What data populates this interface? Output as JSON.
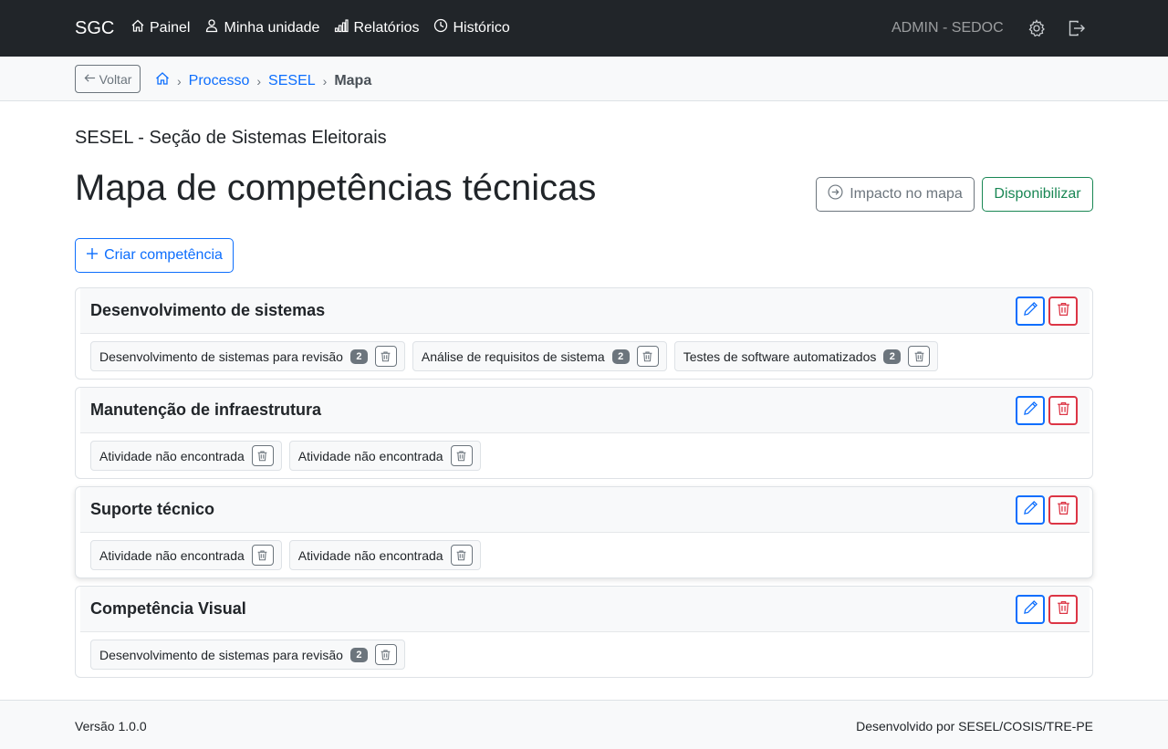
{
  "navbar": {
    "brand": "SGC",
    "links": [
      {
        "label": "Painel",
        "icon": "house-icon"
      },
      {
        "label": "Minha unidade",
        "icon": "person-icon"
      },
      {
        "label": "Relatórios",
        "icon": "bar-chart-icon"
      },
      {
        "label": "Histórico",
        "icon": "clock-icon"
      }
    ],
    "user": "ADMIN - SEDOC",
    "settings_icon": "gear-icon",
    "logout_icon": "logout-icon"
  },
  "breadcrumb": {
    "back_label": "Voltar",
    "items": [
      "Processo",
      "SESEL"
    ],
    "current": "Mapa"
  },
  "header": {
    "unit": "SESEL - Seção de Sistemas Eleitorais",
    "title": "Mapa de competências técnicas",
    "impact_label": "Impacto no mapa",
    "publish_label": "Disponibilizar",
    "create_label": "Criar competência"
  },
  "competencias": [
    {
      "title": "Desenvolvimento de sistemas",
      "atividades": [
        {
          "label": "Desenvolvimento de sistemas para revisão",
          "count": "2"
        },
        {
          "label": "Análise de requisitos de sistema",
          "count": "2"
        },
        {
          "label": "Testes de software automatizados",
          "count": "2"
        }
      ]
    },
    {
      "title": "Manutenção de infraestrutura",
      "atividades": [
        {
          "label": "Atividade não encontrada"
        },
        {
          "label": "Atividade não encontrada"
        }
      ]
    },
    {
      "title": "Suporte técnico",
      "atividades": [
        {
          "label": "Atividade não encontrada"
        },
        {
          "label": "Atividade não encontrada"
        }
      ]
    },
    {
      "title": "Competência Visual",
      "atividades": [
        {
          "label": "Desenvolvimento de sistemas para revisão",
          "count": "2"
        }
      ]
    }
  ],
  "footer": {
    "version": "Versão 1.0.0",
    "credit": "Desenvolvido por SESEL/COSIS/TRE-PE"
  },
  "colors": {
    "primary": "#0d6efd",
    "danger": "#dc3545",
    "success": "#198754",
    "secondary": "#6c757d",
    "navbar": "#212529"
  }
}
